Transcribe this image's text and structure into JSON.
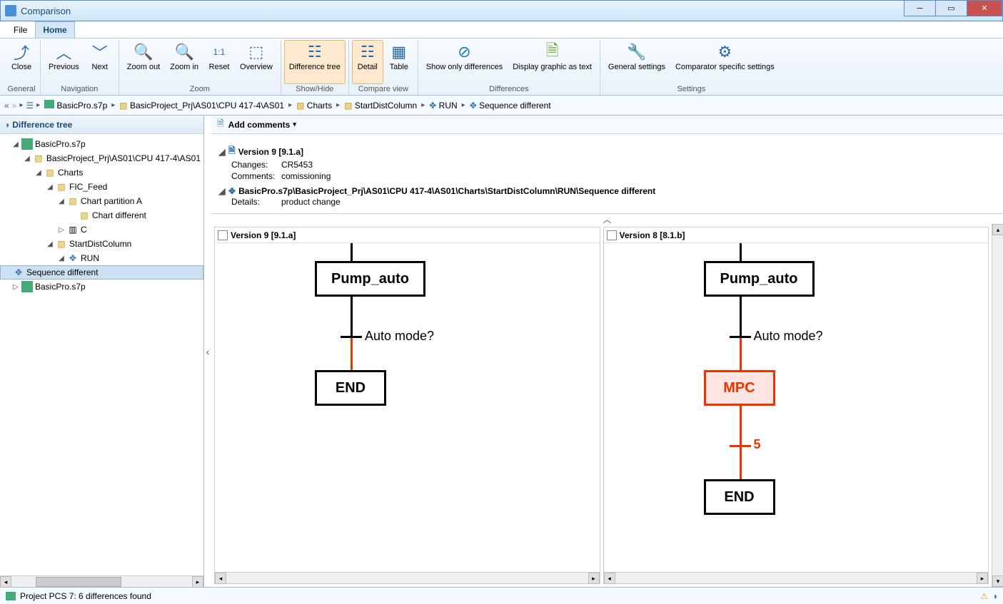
{
  "window": {
    "title": "Comparison"
  },
  "tabs": {
    "file": "File",
    "home": "Home"
  },
  "ribbon": {
    "general": {
      "label": "General",
      "close": "Close"
    },
    "navigation": {
      "label": "Navigation",
      "previous": "Previous",
      "next": "Next"
    },
    "zoom": {
      "label": "Zoom",
      "zoom_out": "Zoom out",
      "zoom_in": "Zoom in",
      "reset": "Reset",
      "overview": "Overview"
    },
    "showhide": {
      "label": "Show/Hide",
      "diff_tree": "Difference tree"
    },
    "compareview": {
      "label": "Compare view",
      "detail": "Detail",
      "table": "Table"
    },
    "differences": {
      "label": "Differences",
      "show_only": "Show only differences",
      "as_text": "Display graphic as text"
    },
    "settings": {
      "label": "Settings",
      "general": "General settings",
      "comparator": "Comparator specific settings"
    }
  },
  "breadcrumb": {
    "items": [
      "BasicPro.s7p",
      "BasicProject_Prj\\AS01\\CPU 417-4\\AS01",
      "Charts",
      "StartDistColumn",
      "RUN",
      "Sequence different"
    ]
  },
  "difftree": {
    "title": "Difference tree",
    "nodes": {
      "n0": "BasicPro.s7p",
      "n1": "BasicProject_Prj\\AS01\\CPU 417-4\\AS01",
      "n2": "Charts",
      "n3": "FIC_Feed",
      "n4": "Chart partition A",
      "n5": "Chart different",
      "n6": "C",
      "n7": "StartDistColumn",
      "n8": "RUN",
      "n9": "Sequence different",
      "n10": "BasicPro.s7p"
    }
  },
  "comments": {
    "add": "Add comments",
    "version9": "Version 9 [9.1.a]",
    "changes_k": "Changes:",
    "changes_v": "CR5453",
    "comments_k": "Comments:",
    "comments_v": "comissioning",
    "path": "BasicPro.s7p\\BasicProject_Prj\\AS01\\CPU 417-4\\AS01\\Charts\\StartDistColumn\\RUN\\Sequence different",
    "details_k": "Details:",
    "details_v": "product change"
  },
  "diagrams": {
    "left": {
      "title": "Version 9 [9.1.a]",
      "box1": "Pump_auto",
      "ask": "Auto mode?",
      "box2": "END"
    },
    "right": {
      "title": "Version 8 [8.1.b]",
      "box1": "Pump_auto",
      "ask": "Auto mode?",
      "box2": "MPC",
      "tick5": "5",
      "box3": "END"
    }
  },
  "status": {
    "text": "Project PCS 7: 6 differences found"
  }
}
